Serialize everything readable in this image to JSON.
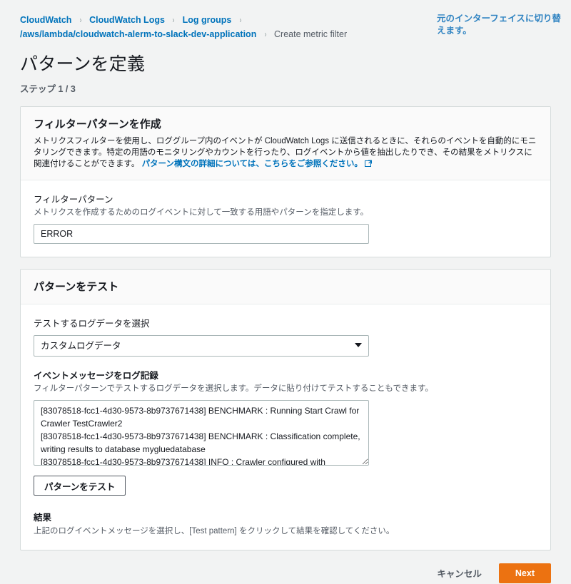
{
  "breadcrumb": {
    "items": [
      {
        "label": "CloudWatch",
        "current": false
      },
      {
        "label": "CloudWatch Logs",
        "current": false
      },
      {
        "label": "Log groups",
        "current": false
      },
      {
        "label": "/aws/lambda/cloudwatch-alerm-to-slack-dev-application",
        "current": false
      },
      {
        "label": "Create metric filter",
        "current": true
      }
    ],
    "separator": "›"
  },
  "switch_interface_link": "元のインターフェイスに切り替えます。",
  "page": {
    "title": "パターンを定義",
    "step": "ステップ 1 / 3"
  },
  "create_pattern_card": {
    "title": "フィルターパターンを作成",
    "description": "メトリクスフィルターを使用し、ロググループ内のイベントが CloudWatch Logs に送信されるときに、それらのイベントを自動的にモニタリングできます。特定の用語のモニタリングやカウントを行ったり、ログイベントから値を抽出したりでき、その結果をメトリクスに関連付けることができます。",
    "doc_link": "パターン構文の詳細については、こちらをご参照ください。",
    "doc_link_icon": "external-link-icon",
    "filter_pattern_label": "フィルターパターン",
    "filter_pattern_hint": "メトリクスを作成するためのログイベントに対して一致する用語やパターンを指定します。",
    "filter_pattern_value": "ERROR",
    "filter_pattern_placeholder": ""
  },
  "test_pattern_card": {
    "title": "パターンをテスト",
    "select_label": "テストするログデータを選択",
    "select_value": "カスタムログデータ",
    "select_caret_icon": "chevron-down-icon",
    "log_events_label": "イベントメッセージをログ記録",
    "log_events_hint": "フィルターパターンでテストするログデータを選択します。データに貼り付けてテストすることもできます。",
    "log_events_value": "[83078518-fcc1-4d30-9573-8b9737671438] BENCHMARK : Running Start Crawl for Crawler TestCrawler2\n[83078518-fcc1-4d30-9573-8b9737671438] BENCHMARK : Classification complete, writing results to database mygluedatabase\n[83078518-fcc1-4d30-9573-8b9737671438] INFO : Crawler configured with SchemaChangePolicy",
    "test_button_label": "パターンをテスト",
    "result_title": "結果",
    "result_text": "上記のログイベントメッセージを選択し、[Test pattern] をクリックして結果を確認してください。"
  },
  "footer": {
    "cancel_label": "キャンセル",
    "next_label": "Next"
  },
  "colors": {
    "page_background": "#f2f3f3",
    "card_background": "#ffffff",
    "link_blue": "#0073bb",
    "accent_orange": "#ec7211",
    "text_primary": "#16191f",
    "text_secondary": "#545b64",
    "border": "#d5dbdb"
  }
}
